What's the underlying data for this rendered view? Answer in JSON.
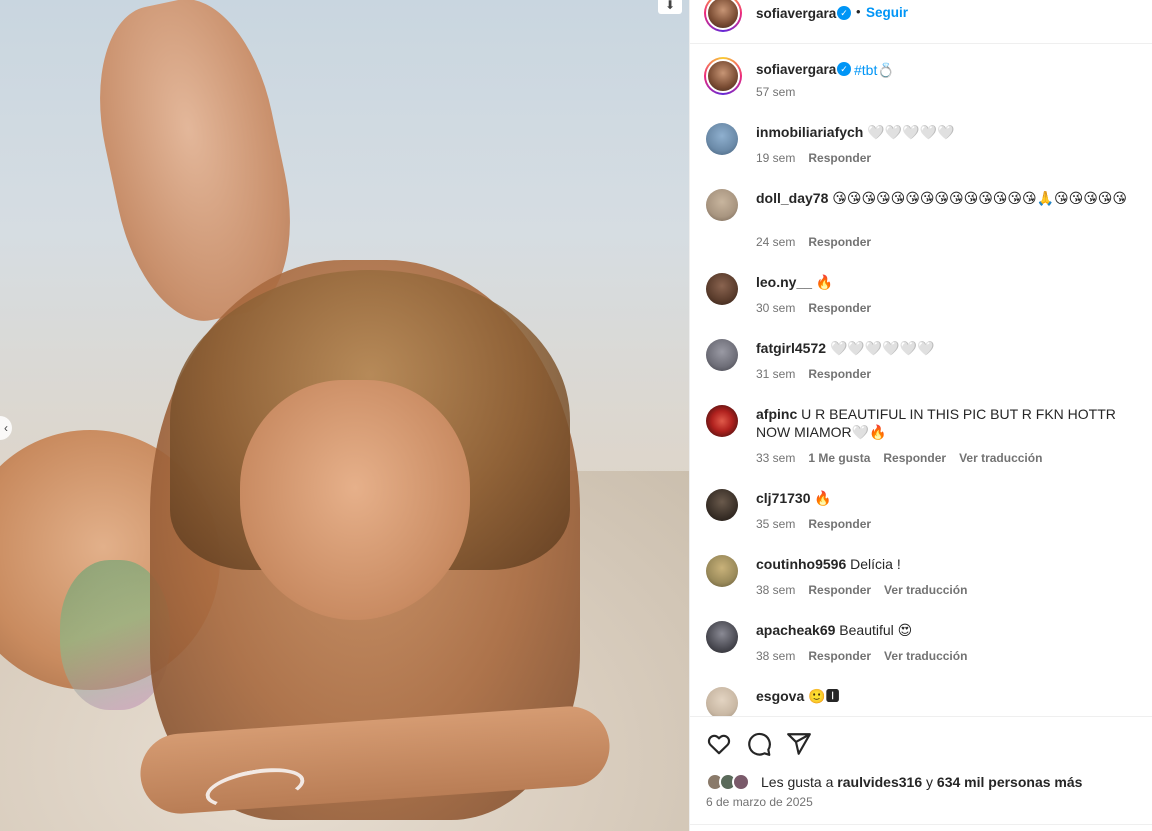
{
  "post": {
    "username": "sofiavergara",
    "verified_glyph": "✓",
    "separator": "•",
    "follow_label": "Seguir",
    "caption_hashtag": "#tbt",
    "caption_emoji": "💍",
    "caption_time": "57 sem"
  },
  "comments": [
    {
      "user": "inmobiliariafych",
      "text": "🤍🤍🤍🤍🤍",
      "time": "19 sem",
      "likes": "",
      "reply": "Responder",
      "translate": "",
      "avatar_color": "#6b8aa8"
    },
    {
      "user": "doll_day78",
      "text": "😘😘😘😘😘😘😘😘😘😘😘😘😘😘🙏😘😘😘😘😘",
      "time": "24 sem",
      "likes": "",
      "reply": "Responder",
      "translate": "",
      "avatar_color": "#a89580"
    },
    {
      "user": "leo.ny__",
      "text": "🔥",
      "time": "30 sem",
      "likes": "",
      "reply": "Responder",
      "translate": "",
      "avatar_color": "#5a3c2c"
    },
    {
      "user": "fatgirl4572",
      "text": "🤍🤍🤍🤍🤍🤍",
      "time": "31 sem",
      "likes": "",
      "reply": "Responder",
      "translate": "",
      "avatar_color": "#6e6e78"
    },
    {
      "user": "afpinc",
      "text": "U R BEAUTIFUL IN THIS PIC BUT R FKN HOTTR NOW MIAMOR🤍🔥",
      "time": "33 sem",
      "likes": "1 Me gusta",
      "reply": "Responder",
      "translate": "Ver traducción",
      "avatar_color": "#b0211e"
    },
    {
      "user": "clj71730",
      "text": "🔥",
      "time": "35 sem",
      "likes": "",
      "reply": "Responder",
      "translate": "",
      "avatar_color": "#3a3028"
    },
    {
      "user": "coutinho9596",
      "text": "Delícia !",
      "time": "38 sem",
      "likes": "",
      "reply": "Responder",
      "translate": "Ver traducción",
      "avatar_color": "#9a8a5a"
    },
    {
      "user": "apacheak69",
      "text": "Beautiful 😍",
      "time": "38 sem",
      "likes": "",
      "reply": "Responder",
      "translate": "Ver traducción",
      "avatar_color": "#4a4a52"
    },
    {
      "user": "esgova",
      "text": "🙂🅸",
      "time": "",
      "likes": "",
      "reply": "",
      "translate": "",
      "avatar_color": "#c9b8a4"
    }
  ],
  "actions": {
    "like_icon": "heart-icon",
    "comment_icon": "comment-icon",
    "share_icon": "share-icon"
  },
  "likes": {
    "prefix": "Les gusta a ",
    "user": "raulvides316",
    "middle": " y ",
    "count": "634 mil personas más"
  },
  "date": "6 de marzo de 2025",
  "colors": {
    "accent": "#0095f6",
    "text": "#262626",
    "muted": "#737373",
    "border": "#efefef"
  }
}
